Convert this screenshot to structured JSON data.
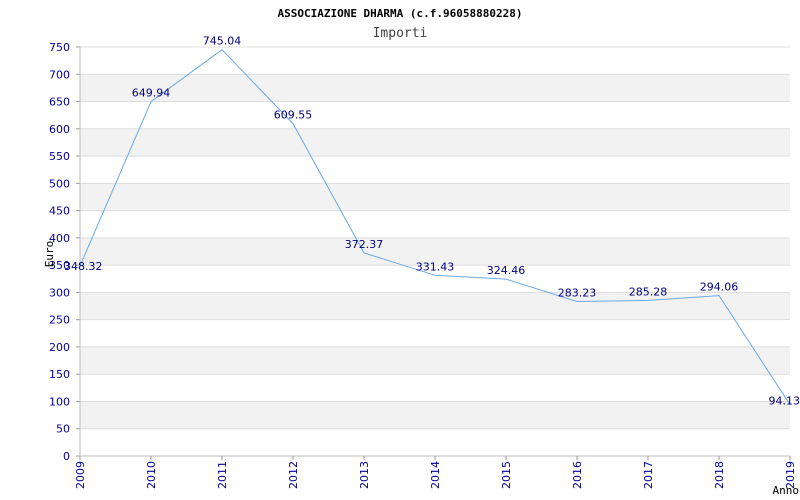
{
  "chart_data": {
    "type": "line",
    "title": "ASSOCIAZIONE DHARMA (c.f.96058880228)",
    "subtitle": "Importi",
    "xlabel": "Anno",
    "ylabel": "Euro",
    "x": [
      2009,
      2010,
      2011,
      2012,
      2013,
      2014,
      2015,
      2016,
      2017,
      2018,
      2019
    ],
    "x_tick_labels": [
      "2009",
      "2010",
      "2011",
      "2012",
      "2013",
      "2014",
      "2015",
      "2016",
      "2017",
      "2018",
      "2019"
    ],
    "values": [
      348.32,
      649.94,
      745.04,
      609.55,
      372.37,
      331.43,
      324.46,
      283.23,
      285.28,
      294.06,
      94.13
    ],
    "data_labels": [
      "348.32",
      "649.94",
      "745.04",
      "609.55",
      "372.37",
      "331.43",
      "324.46",
      "283.23",
      "285.28",
      "294.06",
      "94.13"
    ],
    "y_ticks": [
      0,
      50,
      100,
      150,
      200,
      250,
      300,
      350,
      400,
      450,
      500,
      550,
      600,
      650,
      700,
      750
    ],
    "y_tick_labels": [
      "0",
      "50",
      "100",
      "150",
      "200",
      "250",
      "300",
      "350",
      "400",
      "450",
      "500",
      "550",
      "600",
      "650",
      "700",
      "750"
    ],
    "ylim": [
      0,
      750
    ],
    "xlim": [
      2009,
      2019
    ],
    "grid": true,
    "colors": {
      "line": "#6aaae8",
      "band": "#f2f2f2",
      "gridline": "#dddddd",
      "tick_text": "#000099",
      "label_text": "#000080"
    }
  }
}
